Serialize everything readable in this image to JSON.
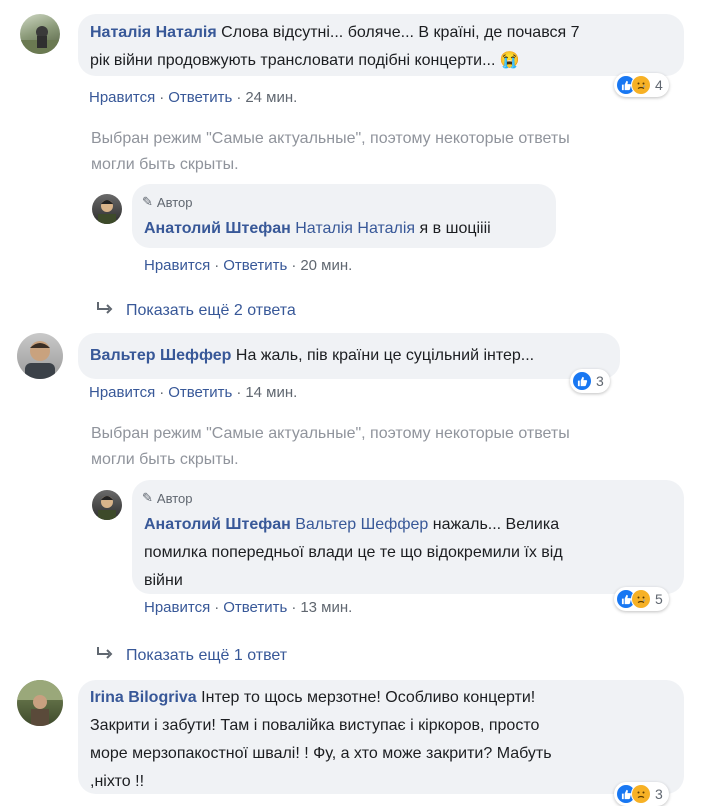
{
  "actions": {
    "like": "Нравится",
    "reply": "Ответить",
    "sep": "·"
  },
  "comments": [
    {
      "author": "Наталія Наталія",
      "text_line1": "Слова відсутні... боляче... В країні, де почався 7",
      "text_line2": "рік війни продовжують трансловати подібні концерти...",
      "emoji": "😭",
      "time": "24 мин.",
      "reaction_count": "4",
      "notice_line1": "Выбран режим \"Самые актуальные\", поэтому некоторые ответы",
      "notice_line2": "могли быть скрыты.",
      "reply": {
        "tag": "Автор",
        "author": "Анатолий Штефан",
        "mention": "Наталія Наталія",
        "text": "я в шоціііі",
        "time": "20 мин."
      },
      "show_more": "Показать ещё 2 ответа"
    },
    {
      "author": "Вальтер Шеффер",
      "text_line1": "На жаль, пів країни це суцільний інтер...",
      "time": "14 мин.",
      "reaction_count": "3",
      "notice_line1": "Выбран режим \"Самые актуальные\", поэтому некоторые ответы",
      "notice_line2": "могли быть скрыты.",
      "reply": {
        "tag": "Автор",
        "author": "Анатолий Штефан",
        "mention": "Вальтер Шеффер",
        "text_line1": "нажаль... Велика",
        "text_line2": "помилка попередньої влади це те що відокремили їх від",
        "text_line3": "війни",
        "time": "13 мин.",
        "reaction_count": "5"
      },
      "show_more": "Показать ещё 1 ответ"
    },
    {
      "author": "Irina Bilogriva",
      "text_line1": "Інтер то щось мерзотне! Особливо концерти!",
      "text_line2": "Закрити і забути! Там і повалійка виступає і кіркоров, просто",
      "text_line3": "море мерзопакостної швалі! ! Фу, а хто може закрити? Мабуть",
      "text_line4": ",ніхто !!",
      "reaction_count": "3"
    }
  ],
  "colors": {
    "link": "#385898",
    "bubble": "#f0f2f5",
    "meta": "#606770",
    "notice": "#90949c",
    "like": "#1877f2",
    "sad": "#f7b125"
  }
}
